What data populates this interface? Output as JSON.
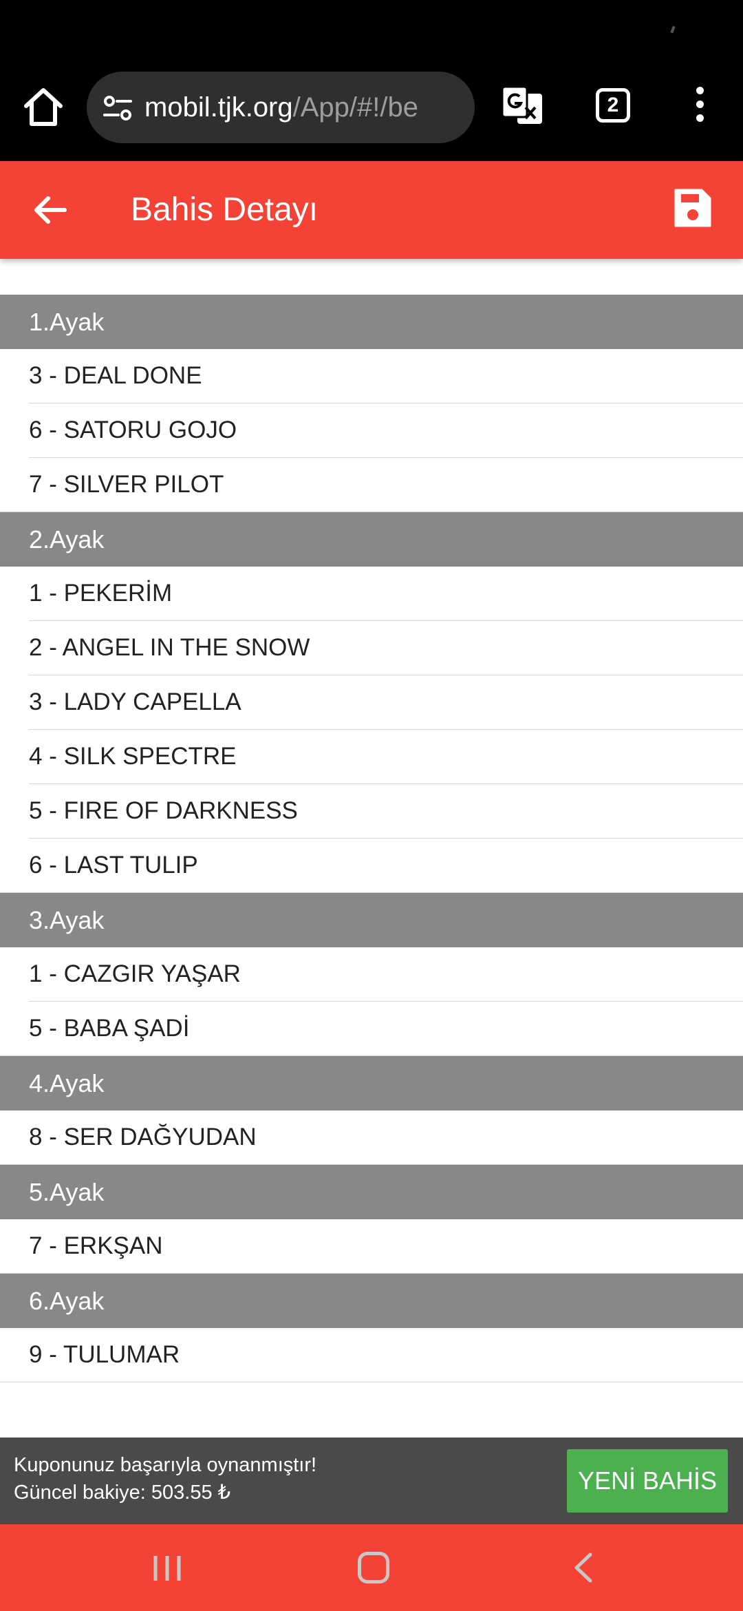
{
  "browser": {
    "url_host": "mobil.tjk.org",
    "url_path": "/App/#!/be",
    "tab_count": "2"
  },
  "header": {
    "title": "Bahis Detayı"
  },
  "legs": [
    {
      "label": "1.Ayak",
      "selections": [
        "3 - DEAL DONE",
        "6 - SATORU GOJO",
        "7 - SILVER PILOT"
      ]
    },
    {
      "label": "2.Ayak",
      "selections": [
        "1 - PEKERİM",
        "2 - ANGEL IN THE SNOW",
        "3 - LADY CAPELLA",
        "4 - SILK SPECTRE",
        "5 - FIRE OF DARKNESS",
        "6 - LAST TULIP"
      ]
    },
    {
      "label": "3.Ayak",
      "selections": [
        "1 - CAZGIR YAŞAR",
        "5 - BABA ŞADİ"
      ]
    },
    {
      "label": "4.Ayak",
      "selections": [
        "8 - SER DAĞYUDAN"
      ]
    },
    {
      "label": "5.Ayak",
      "selections": [
        "7 - ERKŞAN"
      ]
    },
    {
      "label": "6.Ayak",
      "selections": [
        "9 - TULUMAR"
      ]
    }
  ],
  "snackbar": {
    "message_line1": "Kuponunuz başarıyla oynanmıştır!",
    "message_line2": "Güncel bakiye: 503.55 ₺",
    "action_label": "YENİ BAHİS"
  },
  "icons": {
    "home": "home-icon",
    "site_settings": "tune-icon",
    "translate": "translate-icon",
    "menu": "more-vert-icon",
    "back": "arrow-left-icon",
    "save": "save-icon"
  },
  "colors": {
    "primary": "#f44336",
    "leg_header": "#888888",
    "snackbar": "#4a4a4a",
    "action": "#4caf50"
  }
}
